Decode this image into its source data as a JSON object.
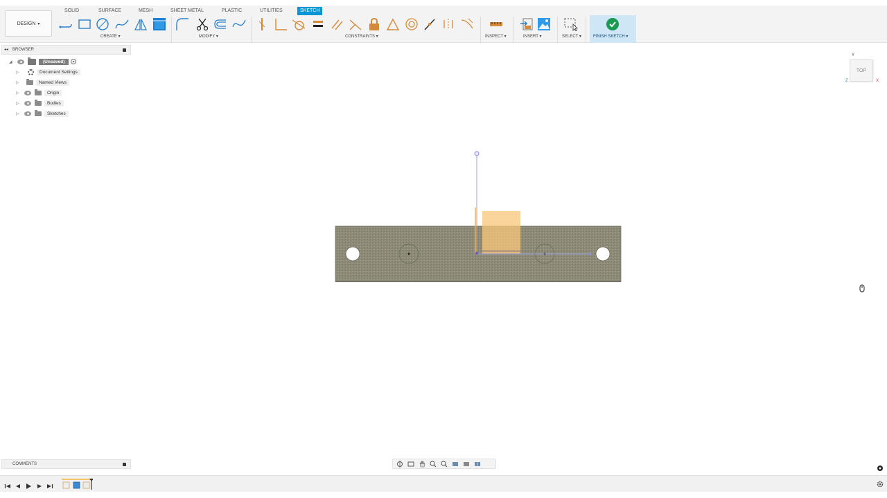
{
  "design_menu": {
    "label": "DESIGN"
  },
  "tabs": [
    {
      "label": "SOLID",
      "active": false
    },
    {
      "label": "SURFACE",
      "active": false
    },
    {
      "label": "MESH",
      "active": false
    },
    {
      "label": "SHEET METAL",
      "active": false
    },
    {
      "label": "PLASTIC",
      "active": false
    },
    {
      "label": "UTILITIES",
      "active": false
    },
    {
      "label": "SKETCH",
      "active": true
    }
  ],
  "groups": {
    "create": "CREATE",
    "modify": "MODIFY",
    "constraints": "CONSTRAINTS",
    "inspect": "INSPECT",
    "insert": "INSERT",
    "select": "SELECT",
    "finish": "FINISH SKETCH"
  },
  "browser": {
    "title": "BROWSER",
    "root": "(Unsaved)",
    "items": [
      {
        "label": "Document Settings",
        "icon": "gear-icon"
      },
      {
        "label": "Named Views",
        "icon": "folder-icon"
      },
      {
        "label": "Origin",
        "icon": "folder-icon"
      },
      {
        "label": "Bodies",
        "icon": "folder-icon"
      },
      {
        "label": "Sketches",
        "icon": "folder-icon"
      }
    ]
  },
  "comments": {
    "title": "COMMENTS"
  },
  "viewcube": {
    "face": "TOP",
    "axis_y": "Y",
    "axis_z": "Z",
    "axis_x": "X"
  },
  "colors": {
    "accent": "#0696d7",
    "finish_bg": "#cfe6f6",
    "finish_check": "#1a9a51",
    "body_fill": "#8d8b78",
    "sketch_profile": "#f8c77a",
    "sketch_line": "#7b7fe0"
  }
}
